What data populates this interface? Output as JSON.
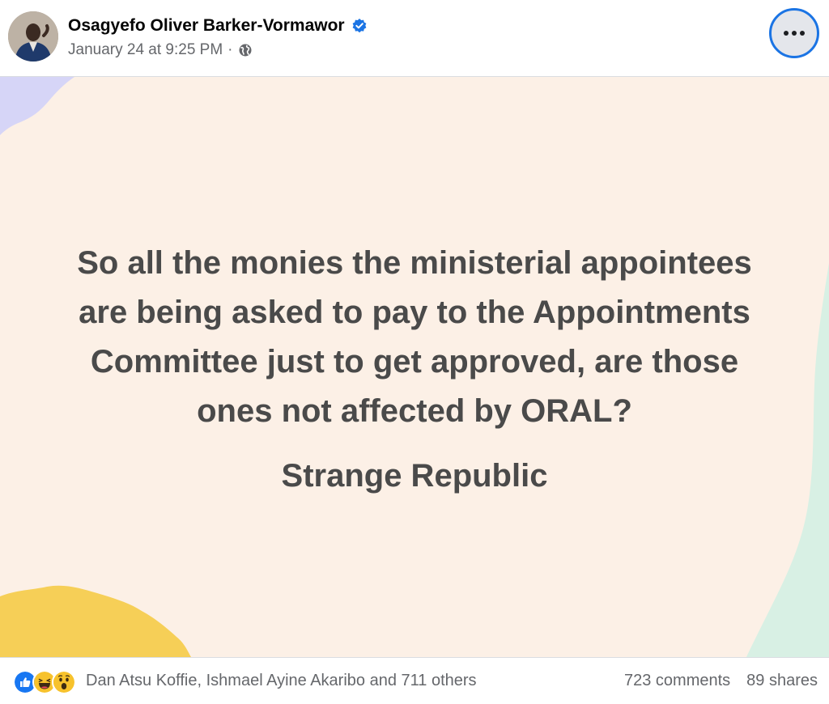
{
  "post": {
    "author": "Osagyefo Oliver Barker-Vormawor",
    "timestamp": "January 24 at 9:25 PM",
    "separator": "·",
    "audience_icon": "globe-icon",
    "verified_icon": "verified-badge-icon",
    "more_icon": "more-options-icon",
    "body_lines": [
      "So all the monies the ministerial appointees",
      "are being asked to pay to the Appointments",
      "Committee just to get approved, are those",
      "ones not affected by ORAL?"
    ],
    "sign_off": "Strange Republic",
    "background_color": "#fcf0e6",
    "text_color": "#4a4a4a"
  },
  "engagement": {
    "reaction_icons": [
      "like-icon",
      "haha-icon",
      "wow-icon"
    ],
    "reactors_text": "Dan Atsu Koffie, Ishmael Ayine Akaribo and 711 others",
    "comments": "723 comments",
    "shares": "89 shares"
  },
  "colors": {
    "accent": "#1b74e4",
    "secondary_text": "#65676b",
    "decor_purple": "#d6d5f7",
    "decor_yellow": "#f6cf57",
    "decor_mint": "#d8f0e4"
  }
}
